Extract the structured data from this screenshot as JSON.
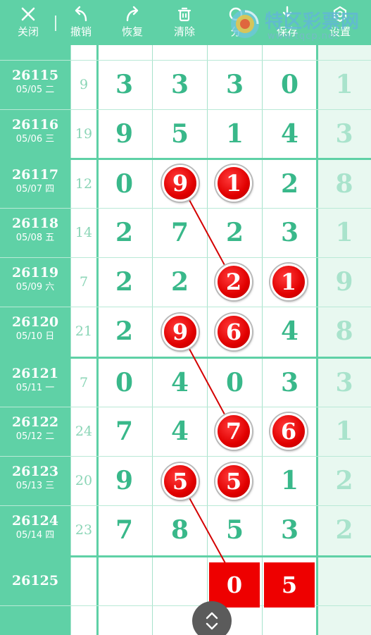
{
  "toolbar": {
    "close": "关闭",
    "undo": "撤销",
    "redo": "恢复",
    "clear": "清除",
    "share": "分",
    "save": "保存",
    "settings": "设置"
  },
  "watermark": {
    "title": "特区彩票网",
    "url": "www.tqcp.net"
  },
  "rows": [
    {
      "period": "26115",
      "date": "05/05 二",
      "sum": "9",
      "digits": [
        "3",
        "3",
        "3",
        "0"
      ],
      "span": "1"
    },
    {
      "period": "26116",
      "date": "05/06 三",
      "sum": "19",
      "digits": [
        "9",
        "5",
        "1",
        "4"
      ],
      "span": "3"
    },
    {
      "period": "26117",
      "date": "05/07 四",
      "sum": "12",
      "digits": [
        "0",
        "9",
        "1",
        "2"
      ],
      "span": "8"
    },
    {
      "period": "26118",
      "date": "05/08 五",
      "sum": "14",
      "digits": [
        "2",
        "7",
        "2",
        "3"
      ],
      "span": "1"
    },
    {
      "period": "26119",
      "date": "05/09 六",
      "sum": "7",
      "digits": [
        "2",
        "2",
        "2",
        "1"
      ],
      "span": "9"
    },
    {
      "period": "26120",
      "date": "05/10 日",
      "sum": "21",
      "digits": [
        "2",
        "9",
        "6",
        "4"
      ],
      "span": "8"
    },
    {
      "period": "26121",
      "date": "05/11 一",
      "sum": "7",
      "digits": [
        "0",
        "4",
        "0",
        "3"
      ],
      "span": "3"
    },
    {
      "period": "26122",
      "date": "05/12 二",
      "sum": "24",
      "digits": [
        "7",
        "4",
        "7",
        "6"
      ],
      "span": "1"
    },
    {
      "period": "26123",
      "date": "05/13 三",
      "sum": "20",
      "digits": [
        "9",
        "5",
        "5",
        "1"
      ],
      "span": "2"
    },
    {
      "period": "26124",
      "date": "05/14 四",
      "sum": "23",
      "digits": [
        "7",
        "8",
        "5",
        "3"
      ],
      "span": "2"
    }
  ],
  "next_row": {
    "period": "26125",
    "pred_1": "0",
    "pred_2": "5"
  },
  "colors": {
    "accent": "#5fd1a6",
    "digit": "#39b88a",
    "highlight": "#e10000"
  }
}
